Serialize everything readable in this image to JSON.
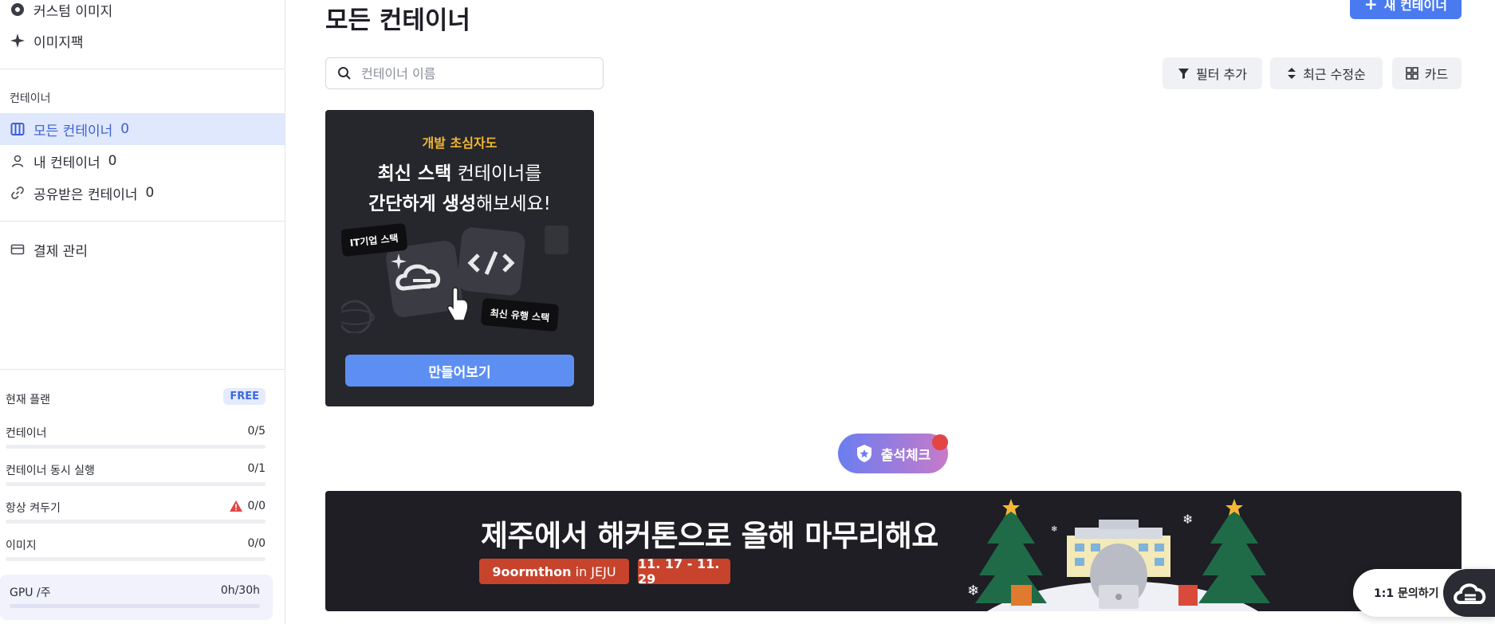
{
  "sidebar": {
    "top_items": [
      {
        "label": "커스텀 이미지",
        "icon": "disc-icon"
      },
      {
        "label": "이미지팩",
        "icon": "sparkle-icon"
      }
    ],
    "section_label": "컨테이너",
    "container_items": [
      {
        "label": "모든 컨테이너",
        "count": "0",
        "icon": "columns-icon",
        "active": true
      },
      {
        "label": "내 컨테이너",
        "count": "0",
        "icon": "user-icon"
      },
      {
        "label": "공유받은 컨테이너",
        "count": "0",
        "icon": "link-icon"
      }
    ],
    "billing": {
      "label": "결제 관리",
      "icon": "card-icon"
    },
    "plan": {
      "label": "현재 플랜",
      "badge": "FREE",
      "rows": [
        {
          "label": "컨테이너",
          "value": "0/5",
          "fill": 0
        },
        {
          "label": "컨테이너 동시 실행",
          "value": "0/1",
          "fill": 0
        },
        {
          "label": "항상 켜두기",
          "value": "0/0",
          "fill": 0,
          "warning": true
        },
        {
          "label": "이미지",
          "value": "0/0",
          "fill": 0
        }
      ],
      "gpu": {
        "label": "GPU /주",
        "value": "0h/30h",
        "fill": 0
      }
    }
  },
  "main": {
    "title": "모든 컨테이너",
    "new_button": "새 컨테이너",
    "search_placeholder": "컨테이너 이름",
    "filter_label": "필터 추가",
    "sort_label": "최근 수정순",
    "view_label": "카드",
    "promo": {
      "kicker": "개발 초심자도",
      "line1_bold": "최신 스택",
      "line1_rest": " 컨테이너를",
      "line2_bold": "간단하게 생성",
      "line2_rest": "해보세요!",
      "tag_it": "IT기업 스택",
      "tag_trend": "최신 유행 스택",
      "cta": "만들어보기"
    },
    "attendance": "출석체크",
    "banner": {
      "headline": "제주에서 해커톤으로 올해 마무리해요",
      "event_name": "9oormthon",
      "event_place": "in JEJU",
      "dates": "11. 17 - 11. 29"
    },
    "help_label": "1:1 문의하기"
  },
  "colors": {
    "accent": "#4a7af0",
    "active_bg": "#dfe8fd",
    "promo_bg": "#26272c",
    "kicker": "#f5b733",
    "banner_pill": "#c7432c",
    "warning": "#e34444"
  }
}
